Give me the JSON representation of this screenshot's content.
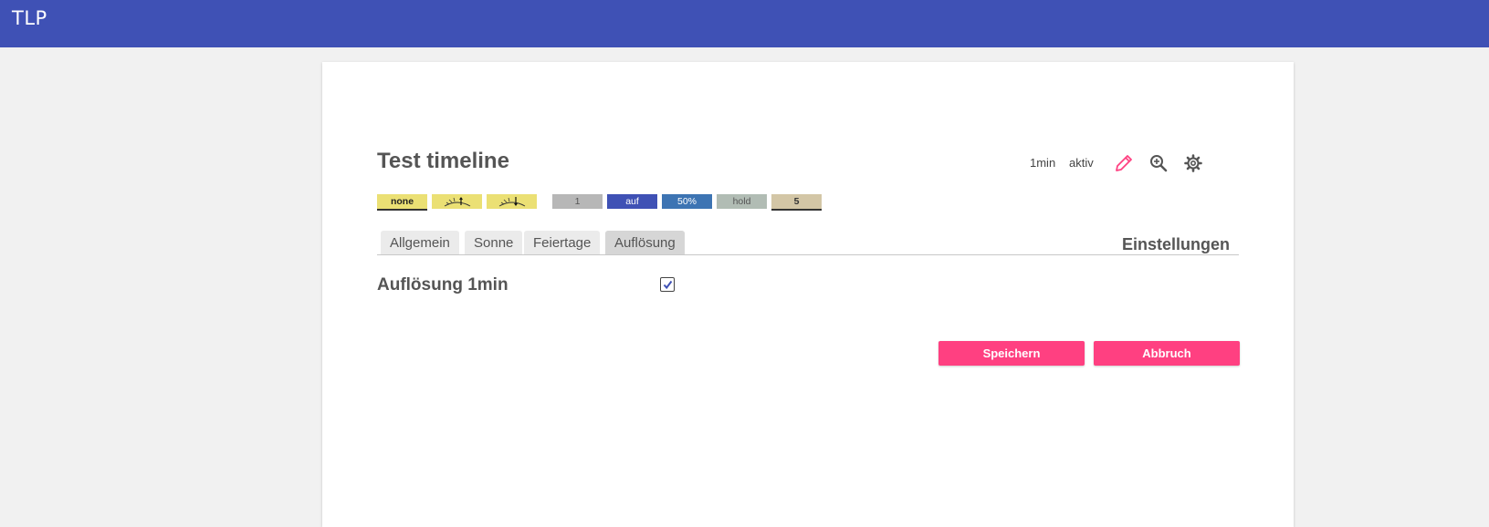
{
  "app": {
    "title": "TLP"
  },
  "timeline": {
    "title": "Test timeline",
    "resolution": "1min",
    "status": "aktiv"
  },
  "icons": {
    "edit": "pencil-icon",
    "zoom": "zoom-in-icon",
    "settings": "gear-icon"
  },
  "chips": [
    {
      "label": "none",
      "color": "#ebe074",
      "type": "text"
    },
    {
      "label": "",
      "color": "#ebe074",
      "type": "sunrise-icon"
    },
    {
      "label": "",
      "color": "#ebe074",
      "type": "sunset-icon"
    },
    {
      "label": "1",
      "color": "#b7b7b7",
      "type": "text"
    },
    {
      "label": "auf",
      "color": "#3f51b5",
      "type": "text"
    },
    {
      "label": "50%",
      "color": "#3d74b3",
      "type": "text"
    },
    {
      "label": "hold",
      "color": "#b1bcb4",
      "type": "text"
    },
    {
      "label": "5",
      "color": "#d3c6a6",
      "type": "text"
    }
  ],
  "tabs": [
    {
      "label": "Allgemein"
    },
    {
      "label": "Sonne"
    },
    {
      "label": "Feiertage"
    },
    {
      "label": "Auflösung",
      "active": true
    }
  ],
  "section": {
    "title": "Einstellungen"
  },
  "setting": {
    "label": "Auflösung 1min",
    "checked": true
  },
  "buttons": {
    "save": "Speichern",
    "cancel": "Abbruch"
  },
  "colors": {
    "header": "#3f51b5",
    "accent": "#ff4081",
    "edit_icon": "#ff4081"
  }
}
